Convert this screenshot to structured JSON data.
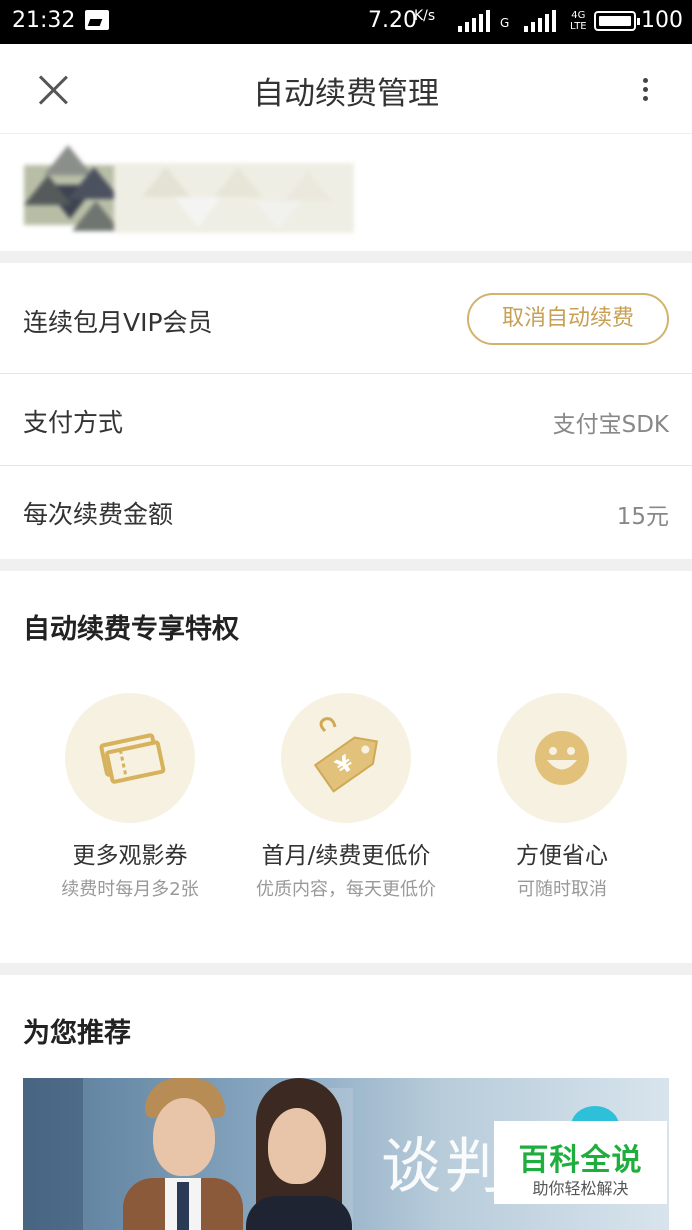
{
  "status_bar": {
    "time": "21:32",
    "net_speed": "7.20",
    "net_speed_unit": "K/s",
    "sim1_type": "G",
    "sim2_type_top": "4G",
    "sim2_type_bottom": "LTE",
    "battery_level": "100"
  },
  "header": {
    "title": "自动续费管理",
    "close_icon": "close-icon",
    "more_icon": "more-vertical-icon"
  },
  "subscription": {
    "plan_label": "连续包月VIP会员",
    "cancel_button": "取消自动续费",
    "payment_label": "支付方式",
    "payment_value": "支付宝SDK",
    "amount_label": "每次续费金额",
    "amount_value": "15元"
  },
  "benefits": {
    "title": "自动续费专享特权",
    "items": [
      {
        "icon": "ticket-icon",
        "title": "更多观影券",
        "subtitle": "续费时每月多2张"
      },
      {
        "icon": "price-tag-icon",
        "title": "首月/续费更低价",
        "subtitle": "优质内容，每天更低价"
      },
      {
        "icon": "smile-icon",
        "title": "方便省心",
        "subtitle": "可随时取消"
      }
    ]
  },
  "recommend": {
    "title": "为您推荐",
    "banner_text": "谈判官"
  },
  "watermark": {
    "title": "百科全说",
    "subtitle": "助你轻松解决"
  },
  "colors": {
    "accent_gold": "#d2b36c",
    "benefit_circle": "#f7f1e1",
    "divider_gray": "#f0f0f0",
    "watermark_green": "#1fae3d"
  }
}
